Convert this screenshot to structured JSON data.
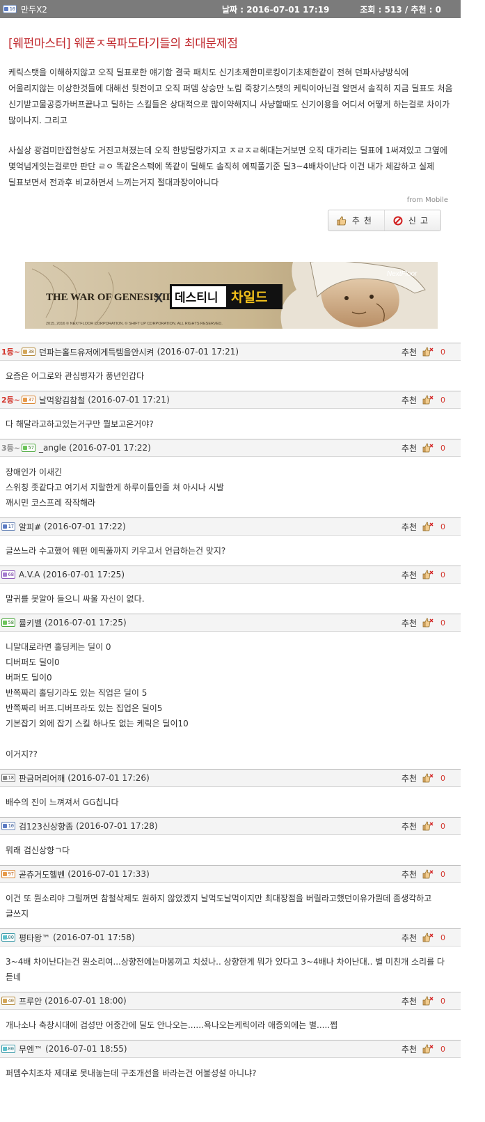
{
  "header": {
    "author": "만두X2",
    "author_level_icon": "level-badge-icon",
    "date_label": "날짜 :",
    "date_value": "2016-07-01 17:19",
    "stats": "조회 : 513 / 추천 : 0"
  },
  "post": {
    "title": "[웨펀마스터] 웨폰ㅈ목파도타기들의 최대문제점",
    "paragraph1": "케릭스탯을 이해하지않고 오직 딜표로한 얘기함 결국 패치도 신기초제한미로킹이기초제한같이 전혀 던파사냥방식에 어울리지않는 이상한것들에 대해선 뒷전이고 오직 퍼뎀 상승만 노림 죽창기스탯의 케릭이아닌걸 알면서 솔직히 지금 딜표도 처음 신기받고물공증가버프끝나고 딜하는 스킬들은 상대적으로 많이약해지니 사냥할때도 신기이용을 어디서 어떻게 하는걸로 차이가 많이나지. 그리고",
    "paragraph2": "사실상 광검미만잡현상도 거진고쳐졌는데 오직 한방딜량가지고 ㅈㄹㅈㄹ해대는거보면 오직 대가리는 딜표에 1써져있고 그옆에 몇억넘게잇는걸로만 판단 ㄹㅇ 똑같은스펙에 똑같이 딜해도 솔직히 에픽풀기준 딜3~4배차이난다 이건 내가 체감하고 실제 딜표보면서 전과후 비교하면서 느끼는거지 절대과장이아니다",
    "from": "from Mobile",
    "recommend_label": "추천",
    "report_label": "신고"
  },
  "banner": {
    "game_title": "THE WAR OF GENESIS III",
    "cross": "X",
    "collab_part1": "데스티니",
    "collab_part2": "차일드",
    "brand": "NextFloor",
    "copyright": "2015, 2016 © NEXTFLOOR CORPORATION. © SHIFT UP CORPORATION. ALL RIGHTS RESERVED."
  },
  "comments": [
    {
      "rank": "1등~",
      "level_color": "tan",
      "level_num": "38",
      "nick": "던파는홀드유저에게득템을안시켜",
      "time": "(2016-07-01 17:21)",
      "reco_label": "추천",
      "reco_count": "0",
      "body": "요즘은 어그로와 관심병자가 풍년인갑다"
    },
    {
      "rank": "2등~",
      "level_color": "orange",
      "level_num": "37",
      "nick": "날먹왕김참철",
      "time": "(2016-07-01 17:21)",
      "reco_label": "추천",
      "reco_count": "0",
      "body": "다 해달라고하고있는거구만 뭘보고온거야?"
    },
    {
      "rank": "3등~",
      "level_color": "green",
      "level_num": "57",
      "nick": "_angle",
      "time": "(2016-07-01 17:22)",
      "reco_label": "추천",
      "reco_count": "0",
      "body": "장애인가 이새긴\n스위칭 좃같다고 여기서 지랄한게 하루이틀인줄 쳐 아시나 시발\n깨시민 코스프레 작작해라"
    },
    {
      "rank": "",
      "level_color": "blue",
      "level_num": "17",
      "nick": "알피#",
      "time": "(2016-07-01 17:22)",
      "reco_label": "추천",
      "reco_count": "0",
      "body": "글쓰느라 수고했어 웨펀 에픽풀까지 키우고서 언급하는건 맞지?"
    },
    {
      "rank": "",
      "level_color": "purple",
      "level_num": "68",
      "nick": "A.V.A",
      "time": "(2016-07-01 17:25)",
      "reco_label": "추천",
      "reco_count": "0",
      "body": "말귀를 못알아 들으니 싸울 자신이 없다."
    },
    {
      "rank": "",
      "level_color": "green",
      "level_num": "58",
      "nick": "률키벨",
      "time": "(2016-07-01 17:25)",
      "reco_label": "추천",
      "reco_count": "0",
      "body": "니말대로라면 홀딩케는 딜이 0\n디버퍼도 딜이0\n버퍼도 딜이0\n반쪽짜리 홀딩기라도 있는 직업은 딜이 5\n반쪽짜리 버프.디버프라도 있는 집업은 딜이5\n기본잡기 외에 잡기 스킬 하나도 없는 케릭은 딜이10\n\n이거지??"
    },
    {
      "rank": "",
      "level_color": "gray",
      "level_num": "118",
      "nick": "판금머리어깨",
      "time": "(2016-07-01 17:26)",
      "reco_label": "추천",
      "reco_count": "0",
      "body": "배수의 진이 느껴져서 GG칩니다"
    },
    {
      "rank": "",
      "level_color": "blue",
      "level_num": "10",
      "nick": "검123신상향좀",
      "time": "(2016-07-01 17:28)",
      "reco_label": "추천",
      "reco_count": "0",
      "body": "뭐래 검신상향ㄱ다"
    },
    {
      "rank": "",
      "level_color": "orange",
      "level_num": "97",
      "nick": "곧츄거도헬벤",
      "time": "(2016-07-01 17:33)",
      "reco_label": "추천",
      "reco_count": "0",
      "body": "이건 또 뭔소리야 그럴꺼면 참철삭제도 원하지 않았겠지 날먹도날먹이지만 최대장점을 버릴라고했던이유가뭔데 좀생각하고 글쓰지"
    },
    {
      "rank": "",
      "level_color": "teal",
      "level_num": "100",
      "nick": "평타왕™",
      "time": "(2016-07-01 17:58)",
      "reco_label": "추천",
      "reco_count": "0",
      "body": "3~4배 차이난다는건 뭔소리여...상향전에는마봉끼고 치셨나..  상향한게 뭐가 있다고 3~4배나 차이난대..  별 미친개 소리를 다 듣네"
    },
    {
      "rank": "",
      "level_color": "tan",
      "level_num": "40",
      "nick": "프루안",
      "time": "(2016-07-01 18:00)",
      "reco_label": "추천",
      "reco_count": "0",
      "body": "개나소나 축창시대에 검성만 어중간에 딜도 안나오는......욕나오는케릭이라 애증외에는 별.....쩝"
    },
    {
      "rank": "",
      "level_color": "teal",
      "level_num": "100",
      "nick": "무엔™",
      "time": "(2016-07-01 18:55)",
      "reco_label": "추천",
      "reco_count": "0",
      "body": "퍼뎀수치조차 제대로 못내놓는데 구조개선을 바라는건 어불성설 아니냐?"
    }
  ]
}
